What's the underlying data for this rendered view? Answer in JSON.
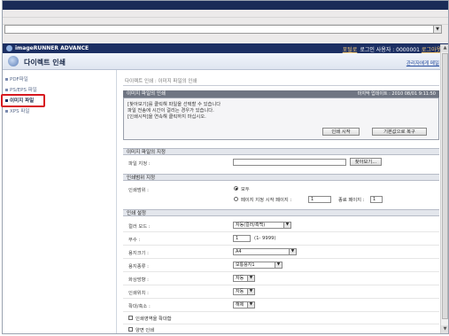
{
  "app": {
    "brand": "imageRUNNER ADVANCE",
    "portal_link": "포털로",
    "user_text": "로그인 사용자 : 0000001",
    "logout": "로그아웃"
  },
  "title": {
    "page_title": "다이렉트 인쇄",
    "admin_link": "관리자에게 메일"
  },
  "sidebar": {
    "items": [
      {
        "label": "PDF파일"
      },
      {
        "label": "PS/EPS 파일"
      },
      {
        "label": "이미지 파일"
      },
      {
        "label": "XPS 파일"
      }
    ]
  },
  "breadcrumb": "다이렉트 인쇄 : 이미지 파일의 인쇄",
  "print_panel": {
    "header": "이미지 파일의 인쇄",
    "updated": "마지막 업데이트 : 2010 08/01 9:11:50",
    "instructions": [
      "[찾아보기]를 클릭해 파일을 선택할 수 있습니다",
      "파일 전송에 시간이 걸리는 경우가 있습니다.",
      "[인쇄시작]을 연속해 클릭하지 마십시오."
    ],
    "start_button": "인쇄 시작",
    "reset_button": "기본값으로 복구"
  },
  "file_section": {
    "header": "이미지 파일의 지정",
    "label": "파일 지정 :",
    "value": "",
    "browse": "찾아보기..."
  },
  "range_section": {
    "header": "인쇄범위 지정",
    "label": "인쇄범위 :",
    "opt_all": "모두",
    "opt_pages": "페이지 지정 시작 페이지 :",
    "start_page": "1",
    "end_label": "종료 페이지 :",
    "end_page": "1"
  },
  "settings": {
    "header": "인쇄 설정",
    "color_label": "컬러 모드 :",
    "color_value": "자동(컬러/흑백)",
    "copies_label": "부수 :",
    "copies_value": "1",
    "copies_hint": "(1- 9999)",
    "paper_label": "용지크기 :",
    "paper_value": "A4",
    "type_label": "용지종류 :",
    "type_value": "보통용지1",
    "orient_label": "화상방향 :",
    "orient_value": "자동",
    "pos_label": "인쇄위치 :",
    "pos_value": "자동",
    "zoom_label": "확대/축소 :",
    "zoom_value": "해제",
    "enlarge_label": "인쇄영역을 확대함",
    "duplex_label": "양면 인쇄"
  }
}
